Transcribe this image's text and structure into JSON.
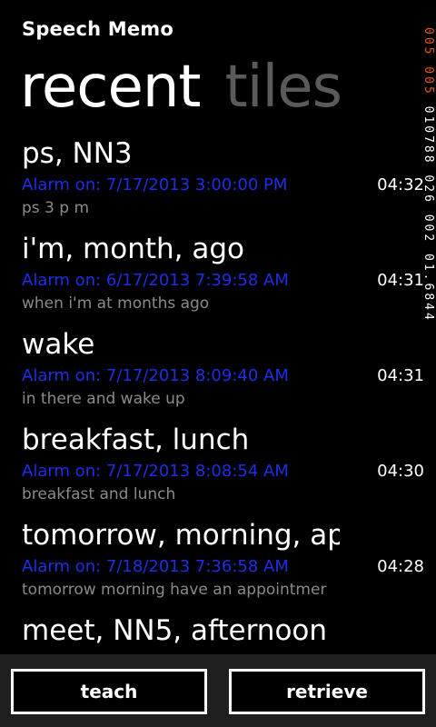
{
  "app": {
    "title": "Speech Memo"
  },
  "pivot": {
    "tabs": [
      {
        "label": "recent",
        "active": true
      },
      {
        "label": "tiles",
        "active": false
      }
    ]
  },
  "memos": [
    {
      "title": "ps, NN3",
      "alarm": "Alarm on: 7/17/2013 3:00:00 PM",
      "time": "04:32",
      "text": "ps 3 p m"
    },
    {
      "title": "i'm, month, ago",
      "alarm": "Alarm on: 6/17/2013 7:39:58 AM",
      "time": "04:31",
      "text": "when i'm at months ago"
    },
    {
      "title": "wake",
      "alarm": "Alarm on: 7/17/2013 8:09:40 AM",
      "time": "04:31",
      "text": "in there and wake up"
    },
    {
      "title": "breakfast, lunch",
      "alarm": "Alarm on: 7/17/2013 8:08:54 AM",
      "time": "04:30",
      "text": "breakfast and lunch"
    },
    {
      "title": "tomorrow, morning, ap",
      "alarm": "Alarm on: 7/18/2013 7:36:58 AM",
      "time": "04:28",
      "text": "tomorrow morning have an appointmer"
    },
    {
      "title": "meet, NN5, afternoon",
      "alarm": "",
      "time": "",
      "text": ""
    }
  ],
  "debug": {
    "orange": "005 005",
    "white": "010788 026 002 01.6844"
  },
  "buttons": {
    "teach": "teach",
    "retrieve": "retrieve"
  },
  "colors": {
    "background": "#000000",
    "alarm_text": "#1e2ee6",
    "inactive_tab": "#5a5a5a",
    "secondary_text": "#8a8a8a",
    "debug_orange": "#e05a1e",
    "button_bar": "#1f1f1f"
  }
}
